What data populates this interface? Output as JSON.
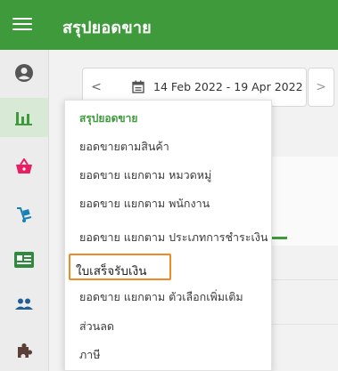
{
  "header": {
    "title": "สรุปยอดขาย",
    "accent_color": "#3f9a3c"
  },
  "sidebar": {
    "items": [
      {
        "icon": "account-circle-icon",
        "active": false
      },
      {
        "icon": "bar-chart-icon",
        "active": true
      },
      {
        "icon": "basket-icon",
        "active": false
      },
      {
        "icon": "hand-truck-icon",
        "active": false
      },
      {
        "icon": "id-card-icon",
        "active": false
      },
      {
        "icon": "people-icon",
        "active": false
      },
      {
        "icon": "puzzle-icon",
        "active": false
      }
    ]
  },
  "date_range": {
    "prev": "<",
    "next": ">",
    "text": "14 Feb 2022 - 19 Apr 2022"
  },
  "menu": {
    "items": [
      {
        "label": "สรุปยอดขาย",
        "active": true
      },
      {
        "label": "ยอดขายตามสินค้า"
      },
      {
        "label": "ยอดขาย แยกตาม หมวดหมู่"
      },
      {
        "label": "ยอดขาย แยกตาม พนักงาน"
      },
      {
        "label": "ยอดขาย แยกตาม ประเภทการชำระเงิน"
      },
      {
        "label": "ใบเสร็จรับเงิน",
        "highlighted": true
      },
      {
        "label": "ยอดขาย แยกตาม ตัวเลือกเพิ่มเติม"
      },
      {
        "label": "ส่วนลด"
      },
      {
        "label": "ภาษี"
      }
    ]
  }
}
